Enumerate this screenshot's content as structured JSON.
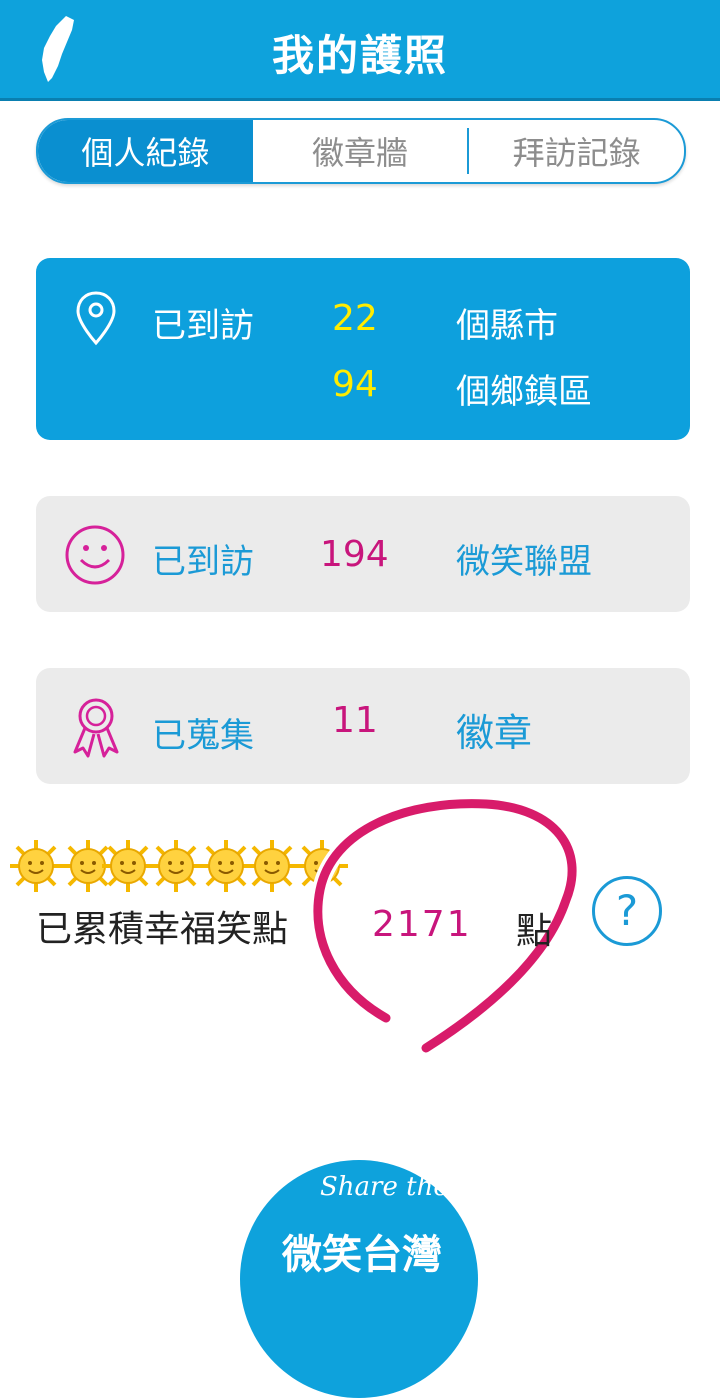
{
  "header": {
    "title": "我的護照"
  },
  "tabs": [
    {
      "label": "個人紀錄",
      "active": true
    },
    {
      "label": "徽章牆",
      "active": false
    },
    {
      "label": "拜訪記錄",
      "active": false
    }
  ],
  "visits": {
    "label": "已到訪",
    "counties_count": "22",
    "counties_unit": "個縣市",
    "towns_count": "94",
    "towns_unit": "個鄉鎮區"
  },
  "smile": {
    "label": "已到訪",
    "count": "194",
    "unit": "微笑聯盟"
  },
  "badges": {
    "label": "已蒐集",
    "count": "11",
    "unit": "徽章"
  },
  "points": {
    "label": "已累積幸福笑點",
    "value": "2171",
    "unit": "點",
    "help": "?"
  },
  "logo": {
    "line1": "Share the Spirit",
    "line2": "微笑台灣"
  },
  "colors": {
    "brand": "#0ea2dc",
    "accent": "#c8157c",
    "highlight": "#ffec00"
  }
}
